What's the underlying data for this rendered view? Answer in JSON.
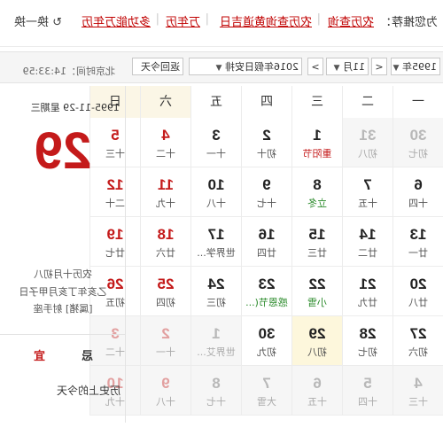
{
  "topbar": {
    "label": "为您推荐：",
    "links": [
      "农历查询",
      "农历查询黄道吉日",
      "万年历",
      "多功能万年历"
    ],
    "refresh": "换一换"
  },
  "controls": {
    "year": "1995年",
    "prev": "<",
    "month": "11月",
    "next": ">",
    "holiday": "2016年假日安排",
    "back_today": "返回今天",
    "beijing_time": "北京时间：14:33:59"
  },
  "side": {
    "date": "1995-11-29 星期三",
    "day": "29",
    "lunar_date": "农历十月初八",
    "ganzhi": "乙亥年丁亥月甲子日",
    "zodiac": "[属猪] 射手座",
    "yi": "宜",
    "ji": "忌",
    "history": "历史上的今天"
  },
  "weekdays": [
    "一",
    "二",
    "三",
    "四",
    "五",
    "六",
    "日"
  ],
  "weeks": [
    [
      {
        "d": "30",
        "l": "初七",
        "o": 1
      },
      {
        "d": "31",
        "l": "初八",
        "o": 1
      },
      {
        "d": "1",
        "l": "重阳节",
        "f": 1
      },
      {
        "d": "2",
        "l": "初十"
      },
      {
        "d": "3",
        "l": "十一"
      },
      {
        "d": "4",
        "l": "十二"
      },
      {
        "d": "5",
        "l": "十三"
      }
    ],
    [
      {
        "d": "6",
        "l": "十四"
      },
      {
        "d": "7",
        "l": "十五"
      },
      {
        "d": "8",
        "l": "立冬",
        "t": 1
      },
      {
        "d": "9",
        "l": "十七"
      },
      {
        "d": "10",
        "l": "十八"
      },
      {
        "d": "11",
        "l": "十九"
      },
      {
        "d": "12",
        "l": "二十"
      }
    ],
    [
      {
        "d": "13",
        "l": "廿一"
      },
      {
        "d": "14",
        "l": "廿二"
      },
      {
        "d": "15",
        "l": "廿三"
      },
      {
        "d": "16",
        "l": "廿四"
      },
      {
        "d": "17",
        "l": "世界学..."
      },
      {
        "d": "18",
        "l": "廿六"
      },
      {
        "d": "19",
        "l": "廿七"
      }
    ],
    [
      {
        "d": "20",
        "l": "廿八"
      },
      {
        "d": "21",
        "l": "廿九"
      },
      {
        "d": "22",
        "l": "小雪",
        "t": 1
      },
      {
        "d": "23",
        "l": "感恩节(...",
        "t": 1
      },
      {
        "d": "24",
        "l": "初三"
      },
      {
        "d": "25",
        "l": "初四"
      },
      {
        "d": "26",
        "l": "初五"
      }
    ],
    [
      {
        "d": "27",
        "l": "初六"
      },
      {
        "d": "28",
        "l": "初七"
      },
      {
        "d": "29",
        "l": "初八",
        "today": 1
      },
      {
        "d": "30",
        "l": "初九"
      },
      {
        "d": "1",
        "l": "世界艾...",
        "o": 1
      },
      {
        "d": "2",
        "l": "十一",
        "o": 1
      },
      {
        "d": "3",
        "l": "十二",
        "o": 1
      }
    ],
    [
      {
        "d": "4",
        "l": "十三",
        "o": 1
      },
      {
        "d": "5",
        "l": "十四",
        "o": 1
      },
      {
        "d": "6",
        "l": "十五",
        "o": 1
      },
      {
        "d": "7",
        "l": "大雪",
        "o": 1,
        "t": 1
      },
      {
        "d": "8",
        "l": "十七",
        "o": 1
      },
      {
        "d": "9",
        "l": "十八",
        "o": 1
      },
      {
        "d": "10",
        "l": "十九",
        "o": 1
      }
    ]
  ]
}
